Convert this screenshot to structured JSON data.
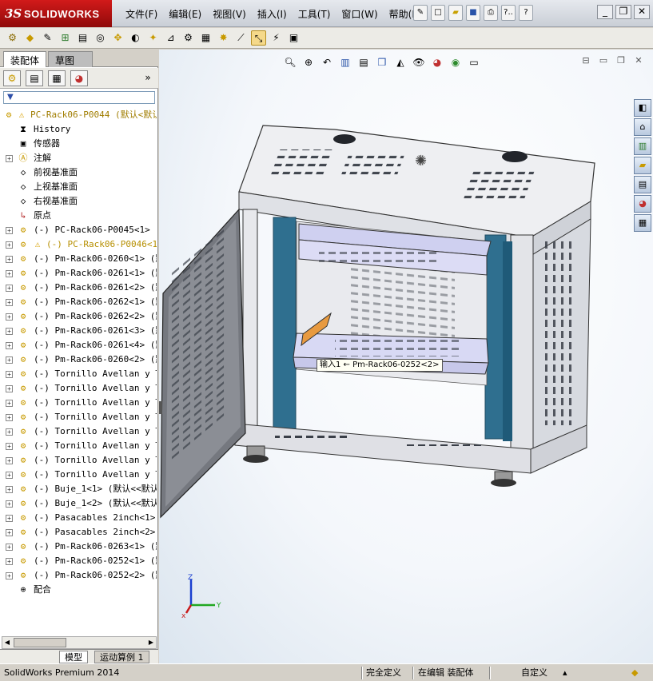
{
  "app": {
    "logo_ds": "3S",
    "logo_name": "SOLIDWORKS",
    "menu": [
      "文件(F)",
      "编辑(E)",
      "视图(V)",
      "插入(I)",
      "工具(T)",
      "窗口(W)",
      "帮助(H)"
    ],
    "search_label": "?..",
    "help_label": "?"
  },
  "panel": {
    "tabs": [
      "装配体",
      "草图"
    ],
    "collapse_label": "»",
    "tree": [
      {
        "kind": "root",
        "label": "PC-Rack06-P0044  (默认<默认",
        "warn": true
      },
      {
        "kind": "leaf",
        "icon": "history-icon",
        "label": "History"
      },
      {
        "kind": "leaf",
        "icon": "sensor-icon",
        "label": "传感器"
      },
      {
        "kind": "node",
        "icon": "annotation-icon",
        "label": "注解"
      },
      {
        "kind": "leaf",
        "icon": "plane-icon",
        "label": "前视基准面"
      },
      {
        "kind": "leaf",
        "icon": "plane-icon",
        "label": "上视基准面"
      },
      {
        "kind": "leaf",
        "icon": "plane-icon",
        "label": "右视基准面"
      },
      {
        "kind": "leaf",
        "icon": "origin-icon",
        "label": "原点"
      },
      {
        "kind": "part",
        "label": "(-) PC-Rack06-P0045<1>  (默"
      },
      {
        "kind": "part",
        "label": "(-) PC-Rack06-P0046<1>",
        "warn": true,
        "dim": true
      },
      {
        "kind": "part",
        "label": "(-) Pm-Rack06-0260<1>  (默认"
      },
      {
        "kind": "part",
        "label": "(-) Pm-Rack06-0261<1>  (默认"
      },
      {
        "kind": "part",
        "label": "(-) Pm-Rack06-0261<2>  (默认"
      },
      {
        "kind": "part",
        "label": "(-) Pm-Rack06-0262<1>  (默认"
      },
      {
        "kind": "part",
        "label": "(-) Pm-Rack06-0262<2>  (默认"
      },
      {
        "kind": "part",
        "label": "(-) Pm-Rack06-0261<3>  (默认"
      },
      {
        "kind": "part",
        "label": "(-) Pm-Rack06-0261<4>  (默认"
      },
      {
        "kind": "part",
        "label": "(-) Pm-Rack06-0260<2>  (默认"
      },
      {
        "kind": "part",
        "label": "(-) Tornillo Avellan y Tue"
      },
      {
        "kind": "part",
        "label": "(-) Tornillo Avellan y Tue"
      },
      {
        "kind": "part",
        "label": "(-) Tornillo Avellan y Tue"
      },
      {
        "kind": "part",
        "label": "(-) Tornillo Avellan y Tue"
      },
      {
        "kind": "part",
        "label": "(-) Tornillo Avellan y Tue"
      },
      {
        "kind": "part",
        "label": "(-) Tornillo Avellan y Tue"
      },
      {
        "kind": "part",
        "label": "(-) Tornillo Avellan y Tue"
      },
      {
        "kind": "part",
        "label": "(-) Tornillo Avellan y Tue"
      },
      {
        "kind": "part",
        "label": "(-) Buje_1<1>  (默认<<默认"
      },
      {
        "kind": "part",
        "label": "(-) Buje_1<2>  (默认<<默认"
      },
      {
        "kind": "part",
        "label": "(-) Pasacables 2inch<1>  (默"
      },
      {
        "kind": "part",
        "label": "(-) Pasacables 2inch<2>  (默"
      },
      {
        "kind": "part",
        "label": "(-) Pm-Rack06-0263<1>  (默认"
      },
      {
        "kind": "part",
        "label": "(-) Pm-Rack06-0252<1>  (默认"
      },
      {
        "kind": "part",
        "label": "(-) Pm-Rack06-0252<2>  (默认"
      },
      {
        "kind": "leaf",
        "icon": "mates-icon",
        "label": "配合"
      }
    ],
    "bottom_tabs": [
      "模型",
      "运动算例 1"
    ]
  },
  "viewport": {
    "callout": "输入1 ← Pm-Rack06-0252<2>",
    "triad": {
      "x": "x",
      "y": "Y",
      "z": "Z"
    }
  },
  "status": {
    "left": "SolidWorks Premium 2014",
    "defined": "完全定义",
    "editing": "在编辑 装配体",
    "custom": "自定义"
  }
}
